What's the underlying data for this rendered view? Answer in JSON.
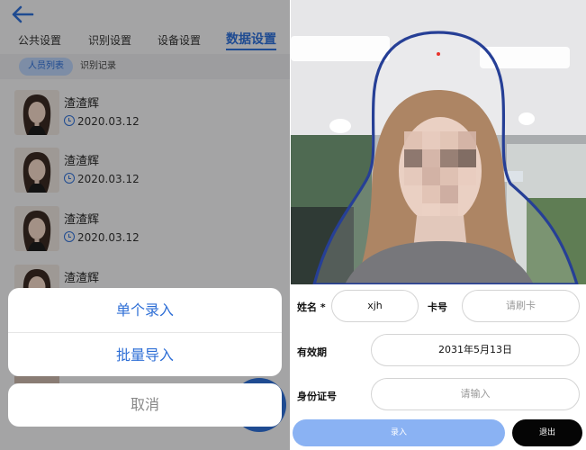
{
  "left": {
    "tabs": [
      "公共设置",
      "识别设置",
      "设备设置",
      "数据设置"
    ],
    "subtabs": [
      "人员列表",
      "识别记录"
    ],
    "records": [
      {
        "name": "渣渣辉",
        "date": "2020.03.12"
      },
      {
        "name": "渣渣辉",
        "date": "2020.03.12"
      },
      {
        "name": "渣渣辉",
        "date": "2020.03.12"
      },
      {
        "name": "渣渣辉",
        "date": ""
      }
    ],
    "sheet": {
      "single": "单个录入",
      "batch": "批量导入",
      "cancel": "取消"
    }
  },
  "right": {
    "form": {
      "name_label": "姓名 *",
      "name_value": "xjh",
      "card_label": "卡号",
      "card_placeholder": "请刷卡",
      "valid_label": "有效期",
      "valid_value": "2031年5月13日",
      "id_label": "身份证号",
      "id_placeholder": "请输入"
    },
    "buttons": {
      "submit": "录入",
      "exit": "退出"
    }
  },
  "colors": {
    "accent": "#2f6fd6",
    "submit_bg": "#8ab2f3",
    "exit_bg": "#050505"
  }
}
